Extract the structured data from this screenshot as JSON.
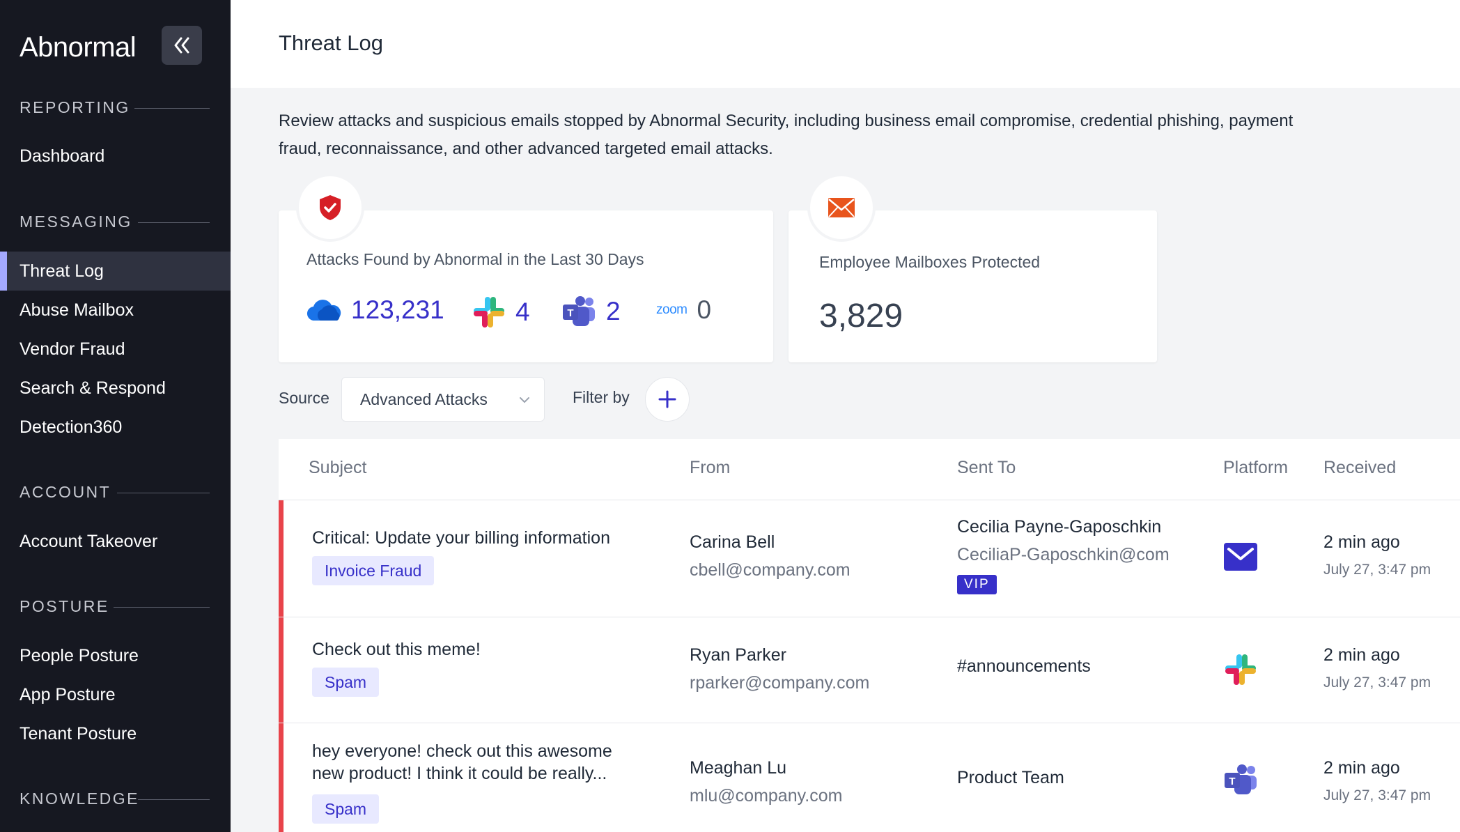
{
  "brand": {
    "name": "Abnormal"
  },
  "sidebar": {
    "sections": [
      {
        "label": "REPORTING",
        "items": [
          "Dashboard"
        ]
      },
      {
        "label": "MESSAGING",
        "items": [
          "Threat Log",
          "Abuse Mailbox",
          "Vendor Fraud",
          "Search & Respond",
          "Detection360"
        ]
      },
      {
        "label": "ACCOUNT",
        "items": [
          "Account Takeover"
        ]
      },
      {
        "label": "POSTURE",
        "items": [
          "People Posture",
          "App Posture",
          "Tenant Posture"
        ]
      },
      {
        "label": "KNOWLEDGE",
        "items": []
      }
    ],
    "active_item": "Threat Log"
  },
  "header": {
    "title": "Threat Log"
  },
  "description": "Review attacks and suspicious emails stopped by Abnormal Security, including business email compromise, credential phishing, payment fraud, reconnaissance, and other advanced targeted email attacks.",
  "cards": {
    "attacks": {
      "title": "Attacks Found by Abnormal in the Last 30 Days",
      "stats": [
        {
          "icon": "cloud-icon",
          "value": "123,231"
        },
        {
          "icon": "slack-icon",
          "value": "4"
        },
        {
          "icon": "teams-icon",
          "value": "2"
        },
        {
          "icon": "zoom-icon",
          "label": "zoom",
          "value": "0"
        }
      ]
    },
    "mailboxes": {
      "title": "Employee Mailboxes Protected",
      "value": "3,829"
    }
  },
  "filters": {
    "source_label": "Source",
    "source_value": "Advanced Attacks",
    "filter_label": "Filter by"
  },
  "table": {
    "headers": [
      "Subject",
      "From",
      "Sent To",
      "Platform",
      "Received"
    ],
    "rows": [
      {
        "subject": "Critical: Update your billing information",
        "tag": "Invoice Fraud",
        "from_name": "Carina Bell",
        "from_email": "cbell@company.com",
        "to_name": "Cecilia Payne-Gaposchkin",
        "to_email": "CeciliaP-Gaposchkin@com",
        "to_badge": "VIP",
        "platform": "mail-icon",
        "received_rel": "2 min ago",
        "received_abs": "July 27, 3:47 pm"
      },
      {
        "subject": "Check out this meme!",
        "tag": "Spam",
        "from_name": "Ryan Parker",
        "from_email": "rparker@company.com",
        "to_name": "#announcements",
        "platform": "slack-icon",
        "received_rel": "2 min ago",
        "received_abs": "July 27, 3:47 pm"
      },
      {
        "subject_lines": [
          "hey everyone! check out this awesome",
          "new product! I think it could be really..."
        ],
        "tag": "Spam",
        "from_name": "Meaghan Lu",
        "from_email": "mlu@company.com",
        "to_name": "Product Team",
        "platform": "teams-icon",
        "received_rel": "2 min ago",
        "received_abs": "July 27, 3:47 pm"
      }
    ]
  },
  "colors": {
    "accent": "#3730c9",
    "danger": "#e8434a",
    "sidebar": "#161821",
    "active_indicator": "#a4a9ff"
  }
}
